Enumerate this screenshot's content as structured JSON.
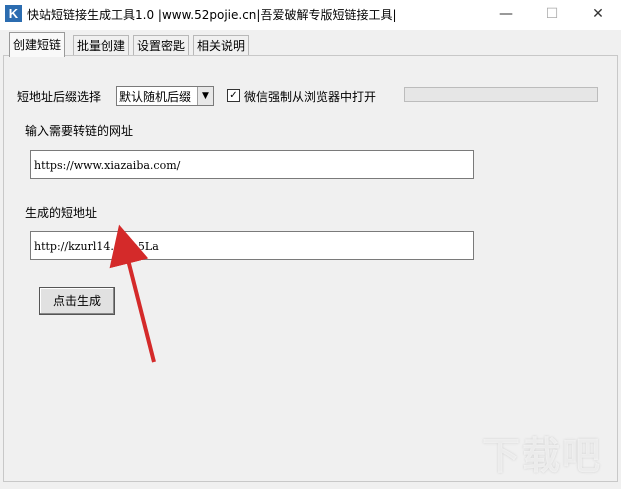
{
  "window": {
    "title": "快站短链接生成工具1.0 |www.52pojie.cn|吾爱破解专版短链接工具|",
    "icon": "K",
    "minimize_glyph": "—",
    "maximize_glyph": "☐",
    "close_glyph": "✕"
  },
  "tabs": [
    {
      "label": "创建短链"
    },
    {
      "label": "批量创建"
    },
    {
      "label": "设置密匙"
    },
    {
      "label": "相关说明"
    }
  ],
  "form": {
    "suffix_label": "短地址后缀选择",
    "suffix_value": "默认随机后缀",
    "wechat_checkbox_checked": true,
    "wechat_checkbox_label": "微信强制从浏览器中打开",
    "url_label": "输入需要转链的网址",
    "url_value": "https://www.xiazaiba.com/",
    "short_label": "生成的短地址",
    "short_value": "http://kzurl14.cn/n5La",
    "generate_button": "点击生成"
  },
  "watermark": "下载吧",
  "colors": {
    "annotation_arrow": "#d42a2a",
    "window_bg": "#f0f0f0"
  },
  "icons": [
    "app-icon",
    "minimize-icon",
    "maximize-icon",
    "close-icon",
    "dropdown-arrow-icon",
    "checkmark-icon"
  ]
}
